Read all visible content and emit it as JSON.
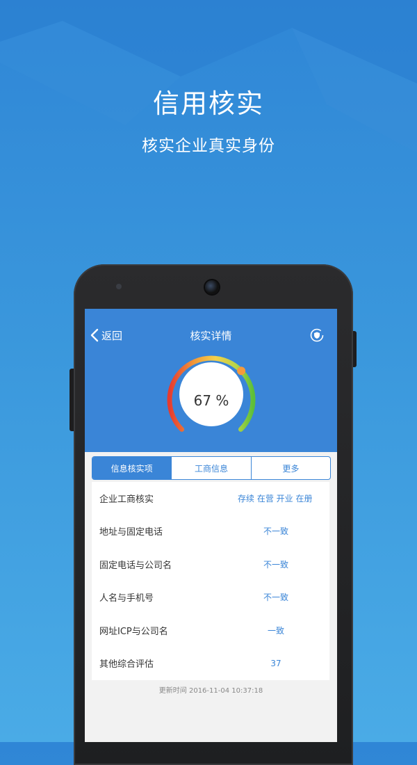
{
  "promo": {
    "title": "信用核实",
    "subtitle": "核实企业真实身份"
  },
  "header": {
    "back_label": "返回",
    "title": "核实详情"
  },
  "gauge": {
    "percent": 67,
    "percent_label": "67 %"
  },
  "tabs": [
    {
      "label": "信息核实项",
      "active": true
    },
    {
      "label": "工商信息",
      "active": false
    },
    {
      "label": "更多",
      "active": false
    }
  ],
  "rows": [
    {
      "label": "企业工商核实",
      "value": "存续 在营 开业 在册"
    },
    {
      "label": "地址与固定电话",
      "value": "不一致"
    },
    {
      "label": "固定电话与公司名",
      "value": "不一致"
    },
    {
      "label": "人名与手机号",
      "value": "不一致"
    },
    {
      "label": "网址ICP与公司名",
      "value": "一致"
    },
    {
      "label": "其他综合评估",
      "value": "37"
    }
  ],
  "footer": {
    "update_time": "更新时间 2016-11-04 10:37:18"
  },
  "colors": {
    "brand_blue": "#3a85d7",
    "gauge_start": "#e53b2f",
    "gauge_mid": "#f5d14a",
    "gauge_end": "#5cbf3a",
    "gauge_marker": "#f59a3c"
  }
}
